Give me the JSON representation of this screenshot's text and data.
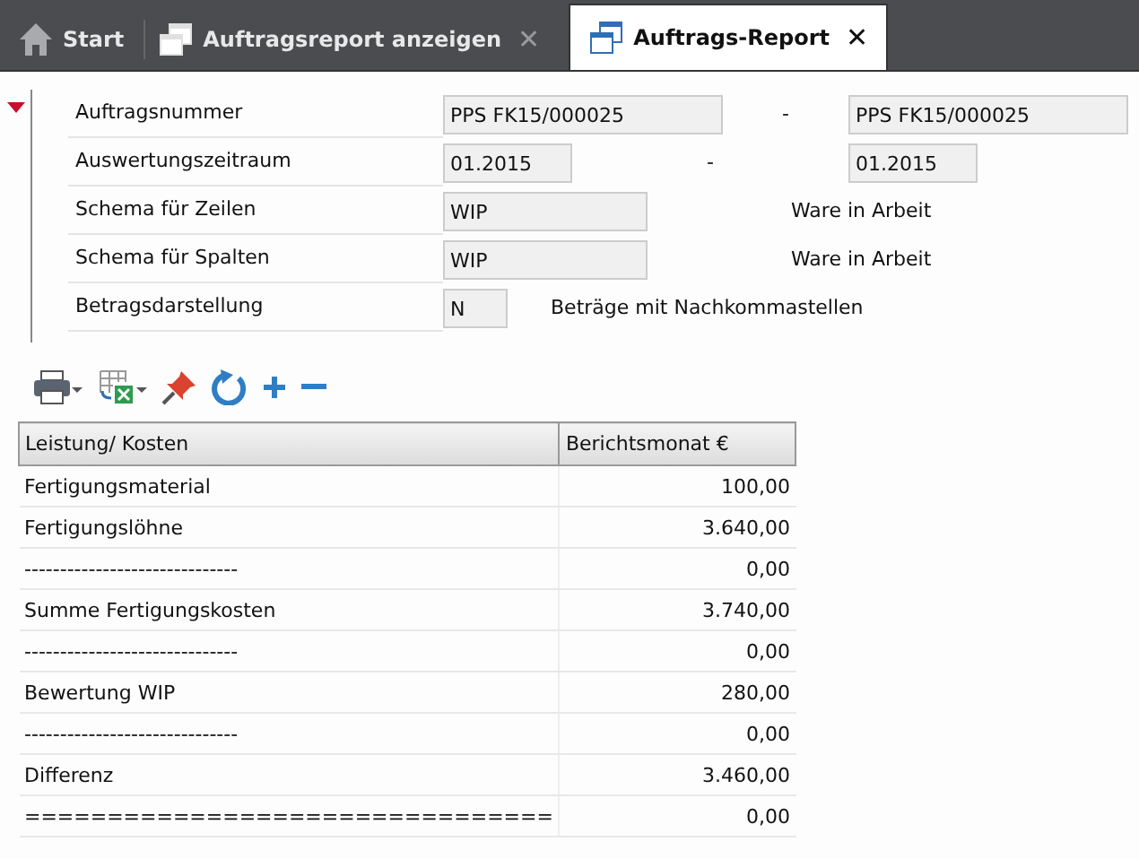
{
  "tabs": [
    {
      "label": "Start",
      "selected": false
    },
    {
      "label": "Auftragsreport anzeigen",
      "selected": false,
      "close": "✕"
    },
    {
      "label": "Auftrags-Report",
      "selected": true,
      "close": "✕"
    }
  ],
  "form": {
    "expanded": true,
    "rows": [
      {
        "label": "Auftragsnummer",
        "from": "PPS FK15/000025",
        "separator": "-",
        "to": "PPS FK15/000025"
      },
      {
        "label": "Auswertungszeitraum",
        "from": "01.2015",
        "separator": "-",
        "to": "01.2015"
      },
      {
        "label": "Schema für Zeilen",
        "from": "WIP",
        "description": "Ware in Arbeit"
      },
      {
        "label": "Schema für Spalten",
        "from": "WIP",
        "description": "Ware in Arbeit"
      },
      {
        "label": "Betragsdarstellung",
        "from": "N",
        "description": "Beträge mit Nachkommastellen"
      }
    ]
  },
  "toolbar": [
    {
      "kind": "print"
    },
    {
      "kind": "excel"
    },
    {
      "kind": "pin"
    },
    {
      "kind": "refresh"
    },
    {
      "kind": "plus"
    },
    {
      "kind": "minus"
    }
  ],
  "table": {
    "columns": [
      "Leistung/ Kosten",
      "Berichtsmonat €"
    ],
    "rows": [
      [
        "Fertigungsmaterial",
        "100,00"
      ],
      [
        "Fertigungslöhne",
        "3.640,00"
      ],
      [
        "------------------------------",
        "0,00"
      ],
      [
        "Summe Fertigungskosten",
        "3.740,00"
      ],
      [
        "------------------------------",
        "0,00"
      ],
      [
        "Bewertung WIP",
        "280,00"
      ],
      [
        "------------------------------",
        "0,00"
      ],
      [
        "Differenz",
        "3.460,00"
      ],
      [
        "================================",
        "0,00"
      ]
    ]
  }
}
